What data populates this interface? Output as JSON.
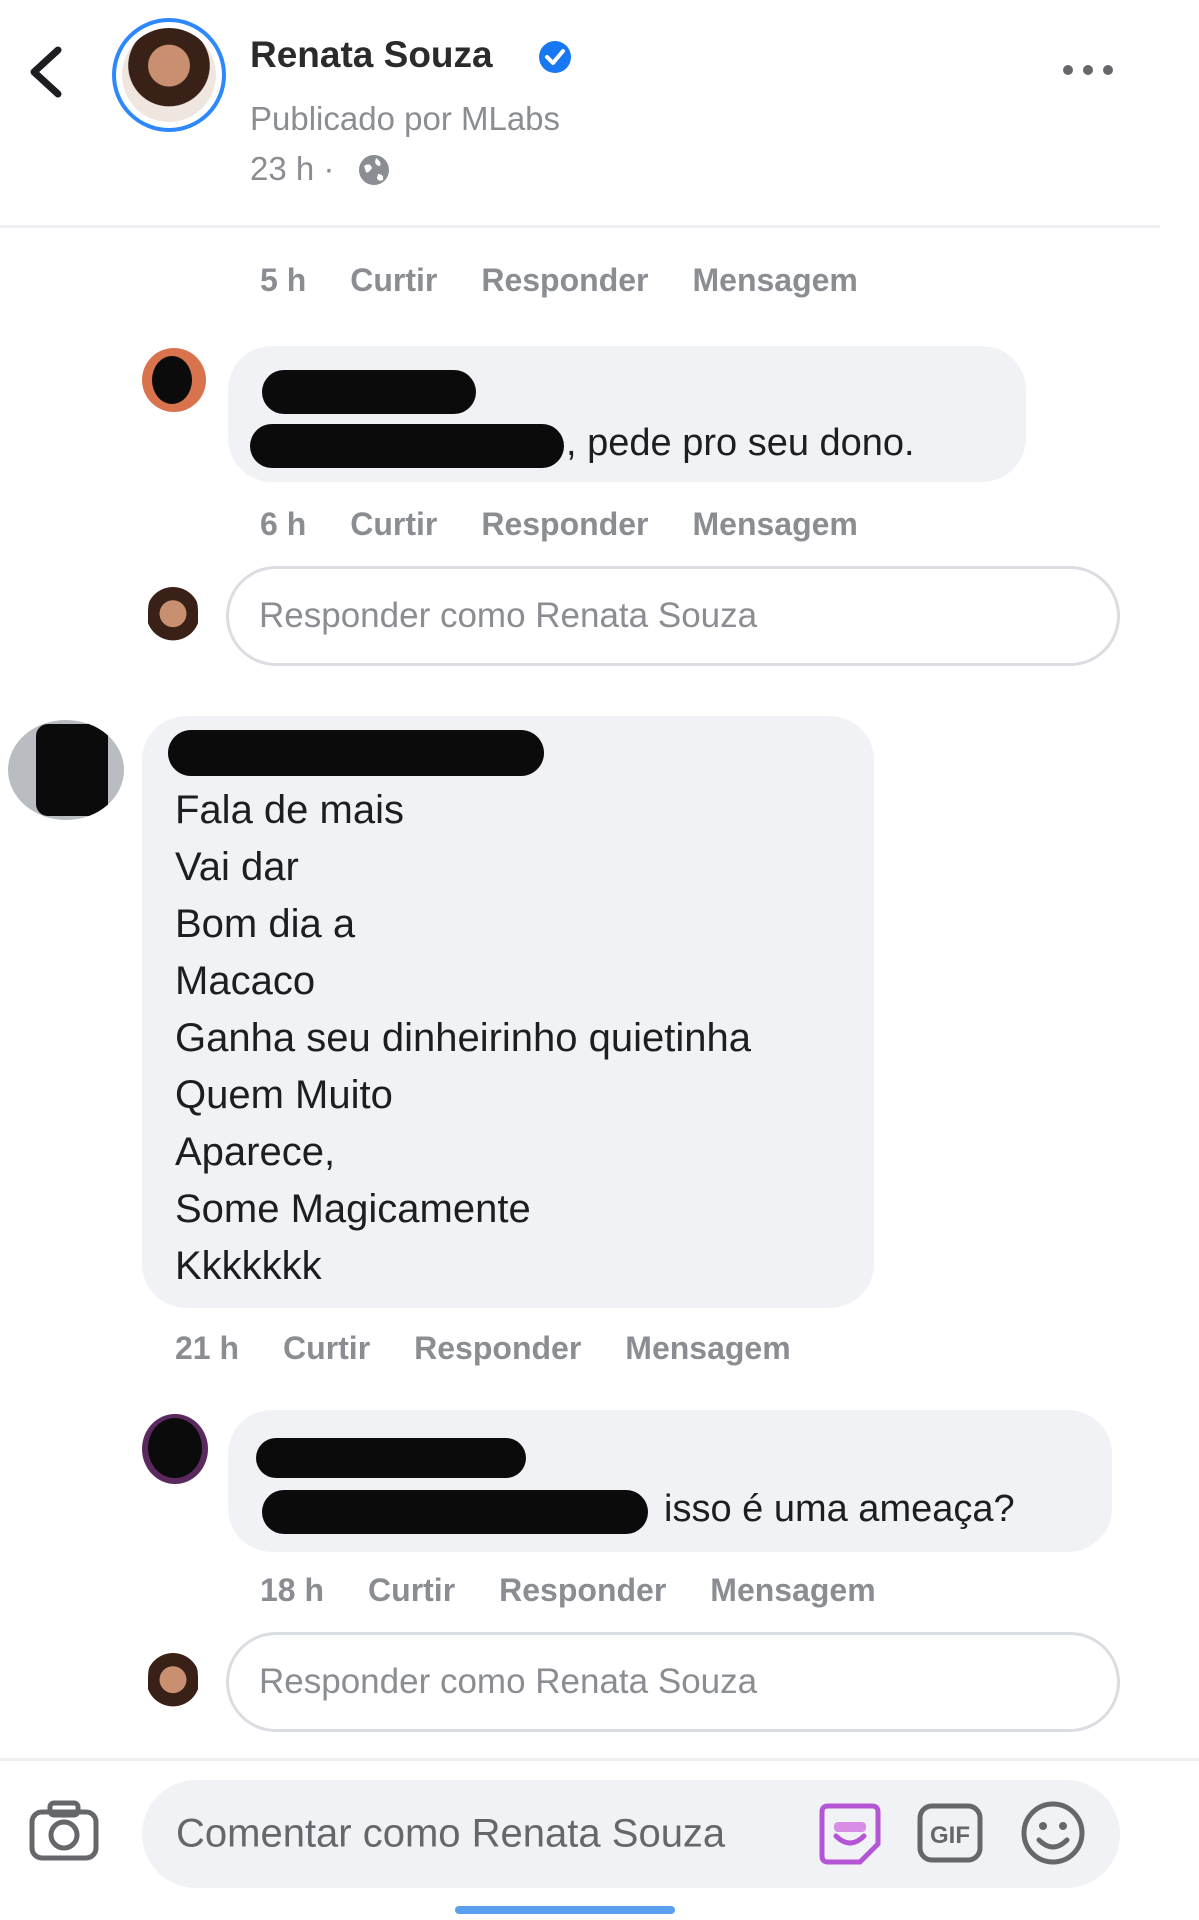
{
  "header": {
    "page_name": "Renata Souza",
    "published_by": "Publicado por MLabs",
    "time": "23 h ·",
    "icons": {
      "back": "chevron-left-icon",
      "verified": "verified-badge-icon",
      "privacy": "globe-icon",
      "more": "more-dots-icon"
    },
    "accent_color": "#2d88ff"
  },
  "comments": [
    {
      "time": "5 h",
      "like": "Curtir",
      "reply": "Responder",
      "message": "Mensagem"
    },
    {
      "text": ", pede pro seu dono.",
      "time": "6 h",
      "like": "Curtir",
      "reply": "Responder",
      "message": "Mensagem"
    },
    {
      "lines": [
        "Fala de mais",
        "Vai dar",
        "Bom dia a",
        "Macaco",
        "Ganha seu dinheirinho quietinha",
        "Quem Muito",
        "Aparece,",
        "Some Magicamente",
        "Kkkkkkk"
      ],
      "time": "21 h",
      "like": "Curtir",
      "reply": "Responder",
      "message": "Mensagem"
    },
    {
      "text": "isso é uma ameaça?",
      "time": "18 h",
      "like": "Curtir",
      "reply": "Responder",
      "message": "Mensagem"
    }
  ],
  "reply_placeholder": "Responder como Renata Souza",
  "composer": {
    "placeholder": "Comentar como Renata Souza",
    "icons": {
      "camera": "camera-icon",
      "sticker": "sticker-icon",
      "gif": "gif-icon",
      "emoji": "emoji-icon"
    },
    "gif_label": "GIF"
  }
}
